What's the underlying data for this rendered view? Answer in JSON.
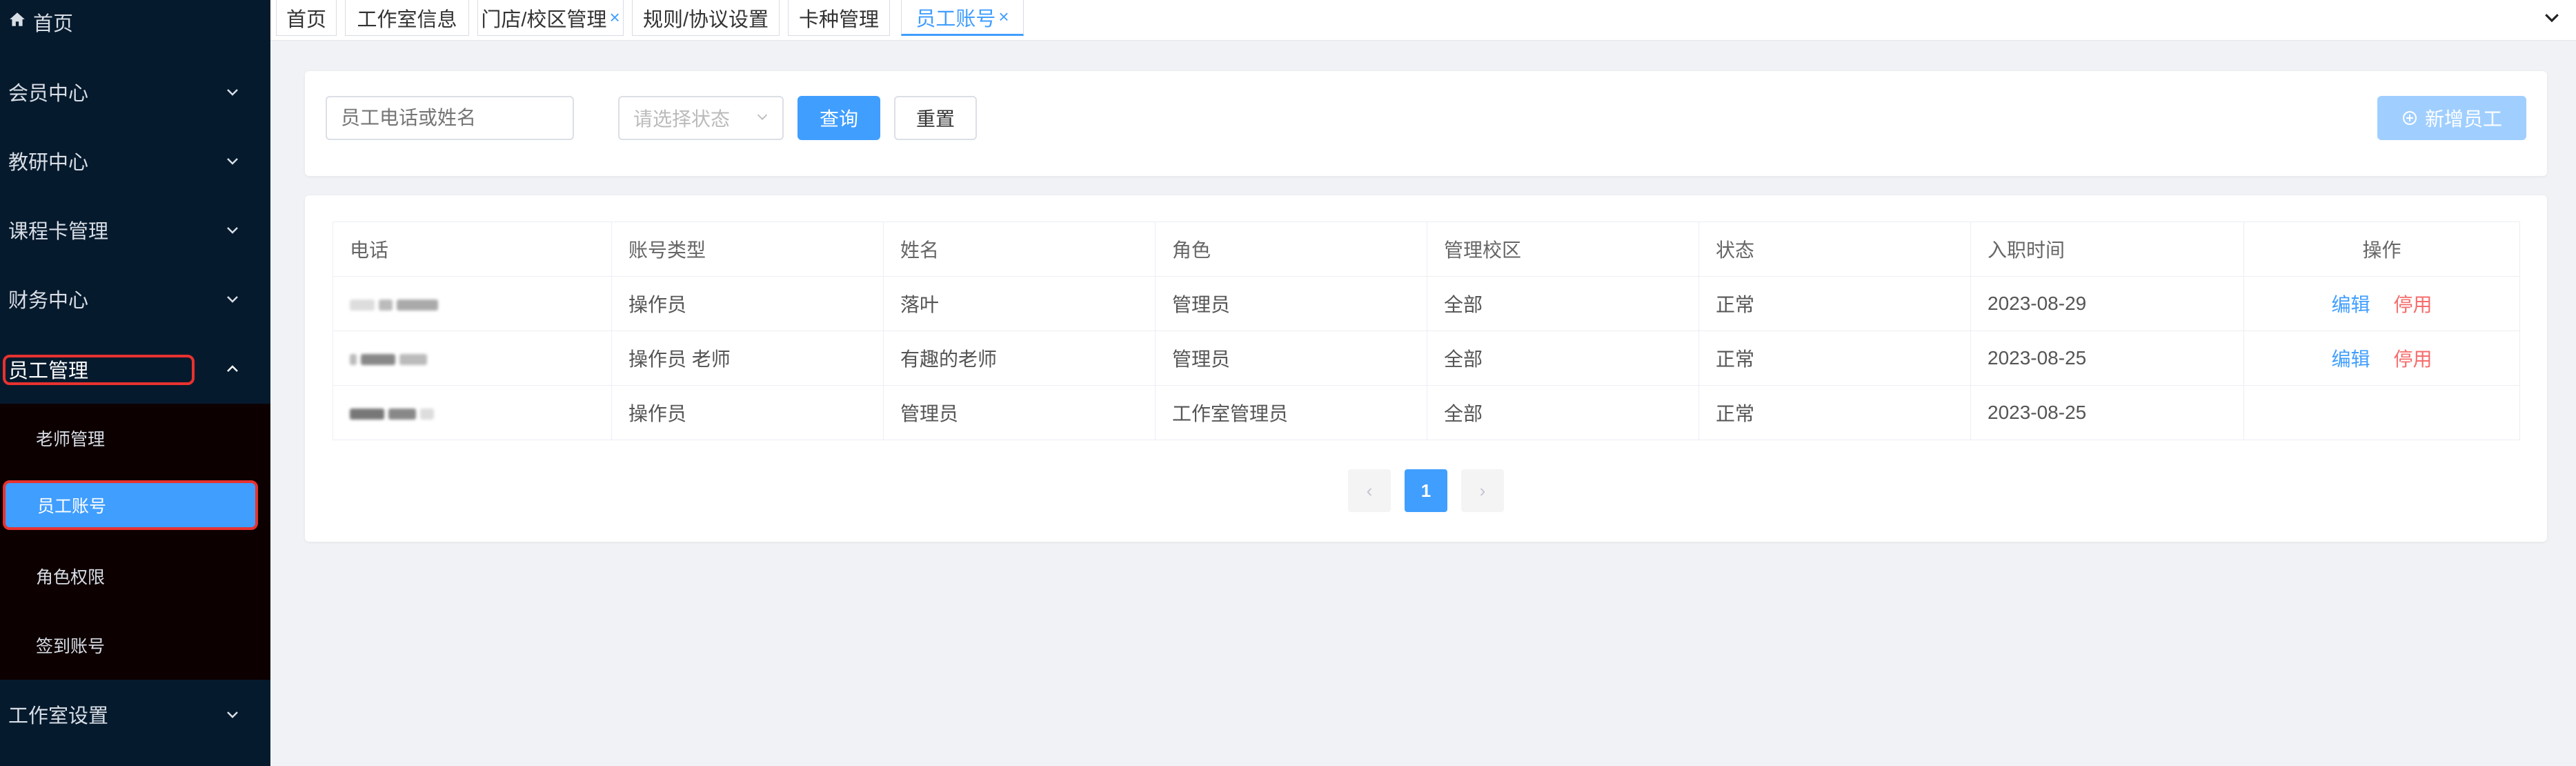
{
  "sidebar": {
    "home": "首页",
    "menus": [
      "会员中心",
      "教研中心",
      "课程卡管理",
      "财务中心",
      "员工管理"
    ],
    "submenu": [
      "老师管理",
      "员工账号",
      "角色权限",
      "签到账号"
    ],
    "studio_settings": "工作室设置"
  },
  "tabs": [
    {
      "label": "首页"
    },
    {
      "label": "工作室信息"
    },
    {
      "label": "门店/校区管理",
      "close": "×"
    },
    {
      "label": "规则/协议设置"
    },
    {
      "label": "卡种管理"
    },
    {
      "label": "员工账号",
      "close": "×"
    }
  ],
  "search": {
    "phone_placeholder": "员工电话或姓名",
    "status_placeholder": "请选择状态",
    "query_label": "查询",
    "reset_label": "重置",
    "add_label": "新增员工"
  },
  "table": {
    "headers": [
      "电话",
      "账号类型",
      "姓名",
      "角色",
      "管理校区",
      "状态",
      "入职时间",
      "操作"
    ],
    "rows": [
      {
        "type": "操作员",
        "name": "落叶",
        "role": "管理员",
        "campus": "全部",
        "status": "正常",
        "date": "2023-08-29",
        "edit": "编辑",
        "stop": "停用"
      },
      {
        "type": "操作员 老师",
        "name": "有趣的老师",
        "role": "管理员",
        "campus": "全部",
        "status": "正常",
        "date": "2023-08-25",
        "edit": "编辑",
        "stop": "停用"
      },
      {
        "type": "操作员",
        "name": "管理员",
        "role": "工作室管理员",
        "campus": "全部",
        "status": "正常",
        "date": "2023-08-25",
        "edit": "",
        "stop": ""
      }
    ]
  },
  "pagination": {
    "prev": "‹",
    "current": "1",
    "next": "›"
  },
  "colors": {
    "primary": "#409eff",
    "danger": "#f56c6c",
    "sidebar": "#061a2d",
    "highlight": "#e8322f"
  }
}
